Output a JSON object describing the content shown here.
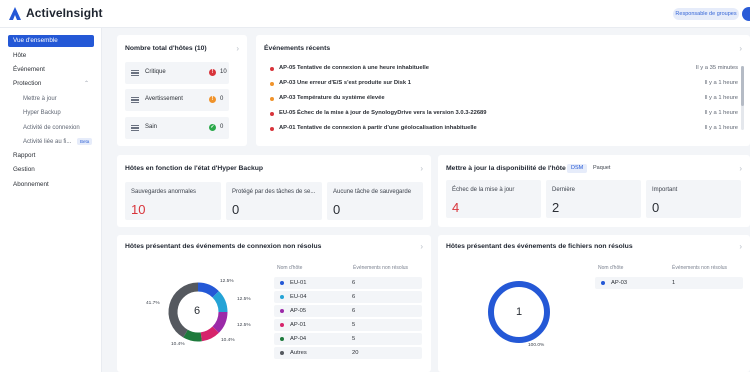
{
  "app": {
    "name": "ActiveInsight",
    "role_badge": "Responsable de groupes"
  },
  "colors": {
    "accent": "#2458d6",
    "critical": "#d8343b",
    "warning": "#f0932b",
    "ok": "#2aa84a"
  },
  "sidebar": {
    "items": [
      {
        "label": "Vue d'ensemble",
        "active": true
      },
      {
        "label": "Hôte"
      },
      {
        "label": "Événement"
      },
      {
        "label": "Protection",
        "expandable": true
      },
      {
        "label": "Mettre à jour",
        "sub": true
      },
      {
        "label": "Hyper Backup",
        "sub": true
      },
      {
        "label": "Activité de connexion",
        "sub": true
      },
      {
        "label": "Activité liée au fi...",
        "sub": true,
        "badge": "Beta"
      },
      {
        "label": "Rapport"
      },
      {
        "label": "Gestion"
      },
      {
        "label": "Abonnement"
      }
    ]
  },
  "hosts": {
    "title": "Nombre total d'hôtes (10)",
    "rows": [
      {
        "label": "Critique",
        "value": "10",
        "icon": "alert-icon",
        "color": "#d8343b"
      },
      {
        "label": "Avertissement",
        "value": "0",
        "icon": "warning-icon",
        "color": "#f0932b"
      },
      {
        "label": "Sain",
        "value": "0",
        "icon": "check-icon",
        "color": "#2aa84a"
      }
    ]
  },
  "events": {
    "title": "Événements récents",
    "rows": [
      {
        "text": "AP-05  Tentative de connexion à une heure inhabituelle",
        "time": "Il y a 35 minutes",
        "color": "#d8343b"
      },
      {
        "text": "AP-03  Une erreur d'E/S s'est produite sur Disk 1",
        "time": "Il y a 1 heure",
        "color": "#f0932b"
      },
      {
        "text": "AP-03  Température du système élevée",
        "time": "Il y a 1 heure",
        "color": "#f0932b"
      },
      {
        "text": "EU-05  Échec de la mise à jour de SynologyDrive vers la version 3.0.3-22689",
        "time": "Il y a 1 heure",
        "color": "#d8343b"
      },
      {
        "text": "AP-01  Tentative de connexion à partir d'une géolocalisation inhabituelle",
        "time": "Il y a 1 heure",
        "color": "#d8343b"
      }
    ]
  },
  "backup": {
    "title": "Hôtes en fonction de l'état d'Hyper Backup",
    "boxes": [
      {
        "label": "Sauvegardes anormales",
        "value": "10"
      },
      {
        "label": "Protégé par des tâches de se...",
        "value": "0"
      },
      {
        "label": "Aucune tâche de sauvegarde",
        "value": "0"
      }
    ]
  },
  "update": {
    "title": "Mettre à jour la disponibilité de l'hôte",
    "toggle": [
      "DSM",
      "Paquet"
    ],
    "boxes": [
      {
        "label": "Échec de la mise à jour",
        "value": "4"
      },
      {
        "label": "Dernière",
        "value": "2"
      },
      {
        "label": "Important",
        "value": "0"
      }
    ]
  },
  "login": {
    "title": "Hôtes présentant des événements de connexion non résolus",
    "total": "6",
    "col_host": "Nom d'hôte",
    "col_events": "Événements non résolus",
    "rows": [
      {
        "name": "EU-01",
        "value": "6",
        "color": "#2458d6"
      },
      {
        "name": "EU-04",
        "value": "6",
        "color": "#24a3d6"
      },
      {
        "name": "AP-05",
        "value": "6",
        "color": "#9b2aa8"
      },
      {
        "name": "AP-01",
        "value": "5",
        "color": "#d6246b"
      },
      {
        "name": "AP-04",
        "value": "5",
        "color": "#1e7a3c"
      },
      {
        "name": "Autres",
        "value": "20",
        "color": "#55595f"
      }
    ],
    "percent_labels": [
      "12.5%",
      "12.5%",
      "12.5%",
      "10.4%",
      "10.4%",
      "41.7%"
    ]
  },
  "files": {
    "title": "Hôtes présentant des événements de fichiers non résolus",
    "total": "1",
    "col_host": "Nom d'hôte",
    "col_events": "Événements non résolus",
    "rows": [
      {
        "name": "AP-03",
        "value": "1",
        "color": "#2458d6"
      }
    ],
    "percent_label": "100.0%"
  },
  "chart_data": [
    {
      "type": "pie",
      "title": "Hôtes présentant des événements de connexion non résolus",
      "categories": [
        "EU-01",
        "EU-04",
        "AP-05",
        "AP-01",
        "AP-04",
        "Autres"
      ],
      "values": [
        6,
        6,
        6,
        5,
        5,
        20
      ],
      "percent": [
        12.5,
        12.5,
        12.5,
        10.4,
        10.4,
        41.7
      ]
    },
    {
      "type": "pie",
      "title": "Hôtes présentant des événements de fichiers non résolus",
      "categories": [
        "AP-03"
      ],
      "values": [
        1
      ],
      "percent": [
        100.0
      ]
    }
  ]
}
